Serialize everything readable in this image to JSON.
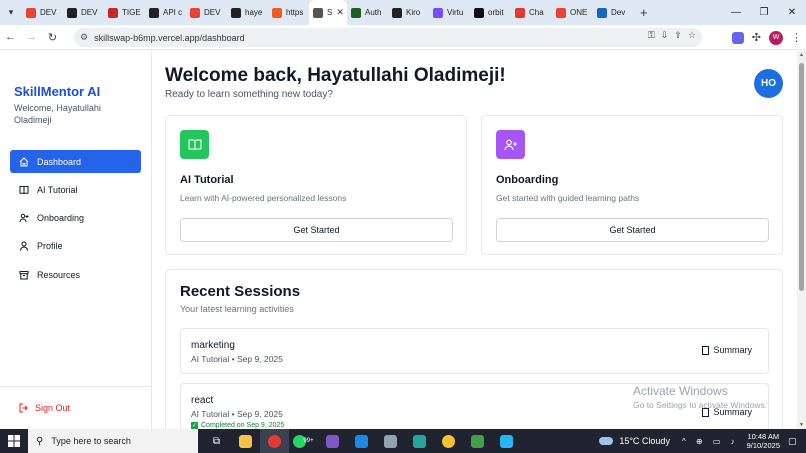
{
  "browser": {
    "tabs": [
      {
        "label": "DEV",
        "icon": "gmail-icon",
        "color": "#ea4335"
      },
      {
        "label": "DEV",
        "icon": "github-icon",
        "color": "#222222"
      },
      {
        "label": "TIGE",
        "icon": "youtube-icon",
        "color": "#c62828"
      },
      {
        "label": "API c",
        "icon": "github-icon",
        "color": "#222222"
      },
      {
        "label": "DEV",
        "icon": "gmail-icon",
        "color": "#ea4335"
      },
      {
        "label": "haye",
        "icon": "github-icon",
        "color": "#222222"
      },
      {
        "label": "https",
        "icon": "postman-icon",
        "color": "#ef5b25"
      },
      {
        "label": "S",
        "icon": "globe-icon",
        "color": "#555555",
        "active": true
      },
      {
        "label": "Auth",
        "icon": "app-icon",
        "color": "#1b5e20"
      },
      {
        "label": "Kiro",
        "icon": "github-icon",
        "color": "#222222"
      },
      {
        "label": "Virtu",
        "icon": "app-icon",
        "color": "#7c4dff"
      },
      {
        "label": "orbit",
        "icon": "app-icon",
        "color": "#111111"
      },
      {
        "label": "Cha",
        "icon": "youtube-icon",
        "color": "#e53935"
      },
      {
        "label": "ONE",
        "icon": "gmail-icon",
        "color": "#ea4335"
      },
      {
        "label": "Dev",
        "icon": "app-icon",
        "color": "#1565c0"
      }
    ],
    "url": "skillswap-b6mp.vercel.app/dashboard",
    "profile_initial": "W"
  },
  "sidebar": {
    "brand": "SkillMentor AI",
    "welcome": "Welcome, Hayatullahi Oladimeji",
    "items": [
      {
        "label": "Dashboard",
        "icon": "home-icon",
        "active": true
      },
      {
        "label": "AI Tutorial",
        "icon": "book-icon",
        "active": false
      },
      {
        "label": "Onboarding",
        "icon": "user-plus-icon",
        "active": false
      },
      {
        "label": "Profile",
        "icon": "user-icon",
        "active": false
      },
      {
        "label": "Resources",
        "icon": "archive-icon",
        "active": false
      }
    ],
    "signout": "Sign Out"
  },
  "main": {
    "title": "Welcome back, Hayatullahi Oladimeji!",
    "subtitle": "Ready to learn something new today?",
    "avatar_initials": "HO",
    "cards": [
      {
        "title": "AI Tutorial",
        "desc": "Learn with AI-powered personalized lessons",
        "button": "Get Started",
        "icon": "book-icon",
        "color": "#22c55e"
      },
      {
        "title": "Onboarding",
        "desc": "Get started with guided learning paths",
        "button": "Get Started",
        "icon": "user-plus-icon",
        "color": "#a855f7"
      }
    ],
    "recent": {
      "title": "Recent Sessions",
      "subtitle": "Your latest learning activities",
      "sessions": [
        {
          "name": "marketing",
          "meta": "AI Tutorial • Sep 9, 2025",
          "button": "Summary"
        },
        {
          "name": "react",
          "meta": "AI Tutorial • Sep 9, 2025",
          "button": "Summary",
          "completed": "Completed on Sep 9, 2025"
        }
      ]
    }
  },
  "watermark": {
    "line1": "Activate Windows",
    "line2": "Go to Settings to activate Windows."
  },
  "taskbar": {
    "search_placeholder": "Type here to search",
    "weather": "15°C  Cloudy",
    "time": "10:48 AM",
    "date": "9/10/2025",
    "badge": "99+"
  }
}
